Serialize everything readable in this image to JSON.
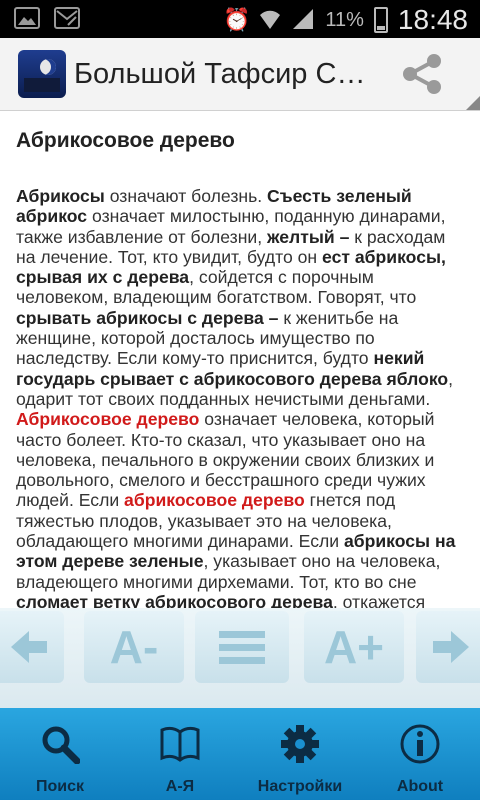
{
  "status_bar": {
    "battery_percent": "11%",
    "time": "18:48"
  },
  "action_bar": {
    "title": "Большой Тафсир Сн..."
  },
  "article": {
    "heading": "Абрикосовое дерево",
    "segments": [
      {
        "t": "Абрикосы",
        "s": "b"
      },
      {
        "t": " означают болезнь. ",
        "s": "n"
      },
      {
        "t": "Съесть зеленый абрикос",
        "s": "b"
      },
      {
        "t": " означает милостыню, поданную динарами, также избавление от болезни, ",
        "s": "n"
      },
      {
        "t": "желтый – ",
        "s": "b"
      },
      {
        "t": "к расходам на лечение. Тот, кто увидит, будто он ",
        "s": "n"
      },
      {
        "t": "ест абрикосы, срывая их с дерева",
        "s": "b"
      },
      {
        "t": ", сойдется с порочным человеком, владеющим богатством. Говорят, что ",
        "s": "n"
      },
      {
        "t": "срывать абрикосы с дерева – ",
        "s": "b"
      },
      {
        "t": "к женитьбе на женщине, которой досталось имущество по наследству. Если кому-то приснится, будто ",
        "s": "n"
      },
      {
        "t": "некий государь срывает с абрикосового дерева яблоко",
        "s": "b"
      },
      {
        "t": ", одарит тот своих подданных нечистыми деньгами. ",
        "s": "n"
      },
      {
        "t": "Абрикосовое дерево",
        "s": "r"
      },
      {
        "t": " означает человека, который часто болеет. Кто-то сказал, что указывает оно на человека, печального в окружении своих близких и довольного, смелого и бесстрашного среди чужих людей. Если ",
        "s": "n"
      },
      {
        "t": "абрикосовое дерево",
        "s": "r"
      },
      {
        "t": " гнется под тяжестью плодов, указывает это на человека, обладающего многими динарами. Если ",
        "s": "n"
      },
      {
        "t": "абрикосы на этом дереве зеленые",
        "s": "b"
      },
      {
        "t": ", указывает оно на человека, владеющего многими дирхемами. Тот, кто во сне ",
        "s": "n"
      },
      {
        "t": "сломает ветку абрикосового дерева",
        "s": "b"
      },
      {
        "t": ", откажется",
        "s": "n"
      }
    ]
  },
  "reader_toolbar": {
    "prev_icon": "arrow-left-icon",
    "font_decrease_label": "A-",
    "menu_icon": "menu-icon",
    "font_increase_label": "A+",
    "next_icon": "arrow-right-icon"
  },
  "bottom_nav": {
    "items": [
      {
        "label": "Поиск",
        "icon": "search-icon"
      },
      {
        "label": "А-Я",
        "icon": "book-icon"
      },
      {
        "label": "Настройки",
        "icon": "gear-icon"
      },
      {
        "label": "About",
        "icon": "info-icon"
      }
    ]
  },
  "colors": {
    "nav_background": "#1a90d0",
    "highlight_red": "#d11a1a"
  }
}
